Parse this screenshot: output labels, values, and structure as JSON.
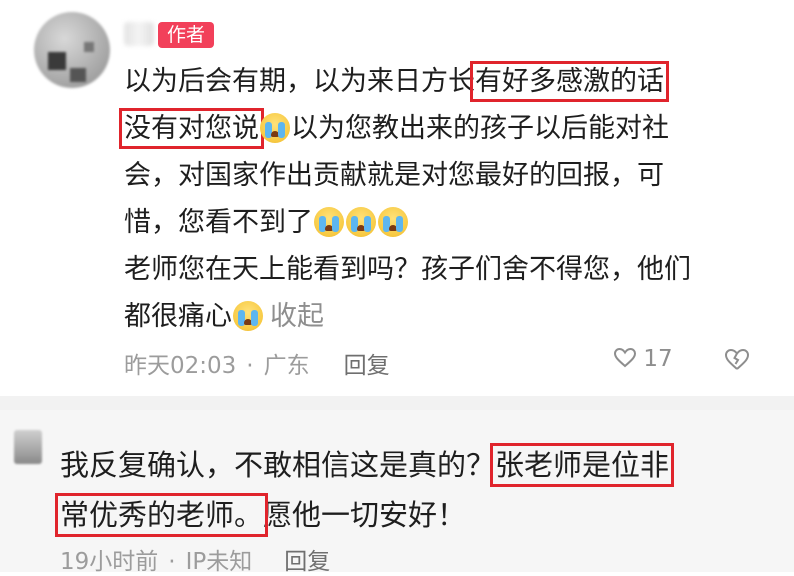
{
  "comment1": {
    "author_badge": "作者",
    "lines": [
      [
        "以为后会有期，以为来日方长",
        "有好多感激的话"
      ],
      [
        "没有对您说",
        "以为您教出来的孩子以后能对社"
      ],
      "会，对国家作出贡献就是对您最好的回报，可",
      "惜，您看不到了",
      "老师您在天上能看到吗？孩子们舍不得您，他们",
      "都很痛心"
    ],
    "collapse": "收起",
    "time": "昨天02:03",
    "separator": "·",
    "location": "广东",
    "reply": "回复",
    "likes": "17"
  },
  "comment2": {
    "line1_plain": "我反复确认，不敢相信这是真的？",
    "line1_highlight": "张老师是位非",
    "line2_highlight": "常优秀的老师。",
    "line2_plain": "愿他一切安好！",
    "time": "19小时前",
    "separator": "·",
    "ip": "IP未知",
    "reply": "回复"
  },
  "icons": {
    "like": "heart-outline-icon",
    "dislike": "broken-heart-outline-icon",
    "emoji": "crying-face-emoji"
  },
  "colors": {
    "badge": "#f2405a",
    "highlight_box": "#e0242c",
    "meta_text": "#9c9c9c"
  }
}
